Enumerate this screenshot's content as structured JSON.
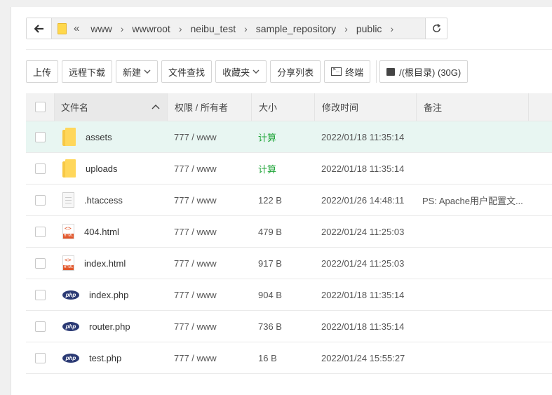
{
  "breadcrumb": {
    "dbl_chevron": "«",
    "separator": "›",
    "items": [
      "www",
      "wwwroot",
      "neibu_test",
      "sample_repository",
      "public"
    ]
  },
  "toolbar": {
    "upload": "上传",
    "remote_download": "远程下载",
    "new": "新建",
    "file_search": "文件查找",
    "favorites": "收藏夹",
    "share_list": "分享列表",
    "terminal": "终端",
    "disk": "/(根目录) (30G)"
  },
  "table": {
    "headers": {
      "name": "文件名",
      "perm": "权限 / 所有者",
      "size": "大小",
      "time": "修改时间",
      "note": "备注"
    },
    "rows": [
      {
        "icon": "folder-icon",
        "name": "assets",
        "perm": "777 / www",
        "size": "计算",
        "time": "2022/01/18 11:35:14",
        "note": ""
      },
      {
        "icon": "folder-icon",
        "name": "uploads",
        "perm": "777 / www",
        "size": "计算",
        "time": "2022/01/18 11:35:14",
        "note": ""
      },
      {
        "icon": "file-icon",
        "name": ".htaccess",
        "perm": "777 / www",
        "size": "122 B",
        "time": "2022/01/26 14:48:11",
        "note": "PS: Apache用户配置文..."
      },
      {
        "icon": "html-icon",
        "name": "404.html",
        "perm": "777 / www",
        "size": "479 B",
        "time": "2022/01/24 11:25:03",
        "note": ""
      },
      {
        "icon": "html-icon",
        "name": "index.html",
        "perm": "777 / www",
        "size": "917 B",
        "time": "2022/01/24 11:25:03",
        "note": ""
      },
      {
        "icon": "php-icon",
        "name": "index.php",
        "perm": "777 / www",
        "size": "904 B",
        "time": "2022/01/18 11:35:14",
        "note": ""
      },
      {
        "icon": "php-icon",
        "name": "router.php",
        "perm": "777 / www",
        "size": "736 B",
        "time": "2022/01/18 11:35:14",
        "note": ""
      },
      {
        "icon": "php-icon",
        "name": "test.php",
        "perm": "777 / www",
        "size": "16 B",
        "time": "2022/01/24 15:55:27",
        "note": ""
      }
    ]
  },
  "icon_labels": {
    "php": "php",
    "html_code": "<>",
    "html_tag": "HTML"
  },
  "colors": {
    "selected_row": "#e8f6f2",
    "calc_green": "#20a53a",
    "folder": "#ffd75b"
  }
}
